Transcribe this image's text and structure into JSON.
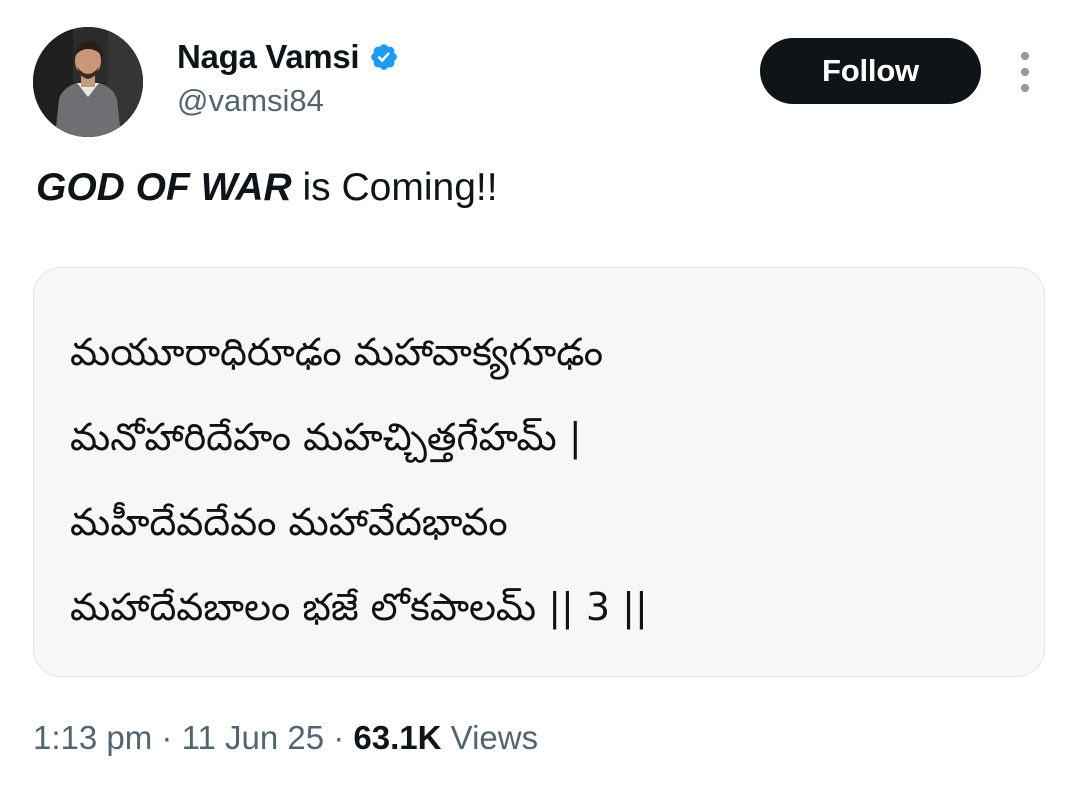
{
  "author": {
    "name": "Naga Vamsi",
    "handle": "@vamsi84",
    "verified": true
  },
  "follow_label": "Follow",
  "tweet": {
    "text_emphasis": "GOD OF WAR",
    "text_rest": " is Coming!!"
  },
  "card": {
    "lines": [
      "మయూరాధిరూఢం మహావాక్యగూఢం",
      "మనోహారిదేహం మహచ్చిత్తగేహమ్ |",
      "మహీదేవదేవం మహావేదభావం",
      "మహాదేవబాలం భజే లోకపాలమ్ || 3 ||"
    ]
  },
  "meta": {
    "time": "1:13 pm",
    "separator": " · ",
    "date": "11 Jun 25",
    "views_count": "63.1K",
    "views_label": " Views"
  },
  "colors": {
    "verified_blue": "#1d9bf0",
    "follow_bg": "#0f1419",
    "secondary_text": "#536471",
    "card_bg": "#f7f7f7"
  },
  "icons": [
    "verified-badge-icon",
    "more-options-icon"
  ]
}
